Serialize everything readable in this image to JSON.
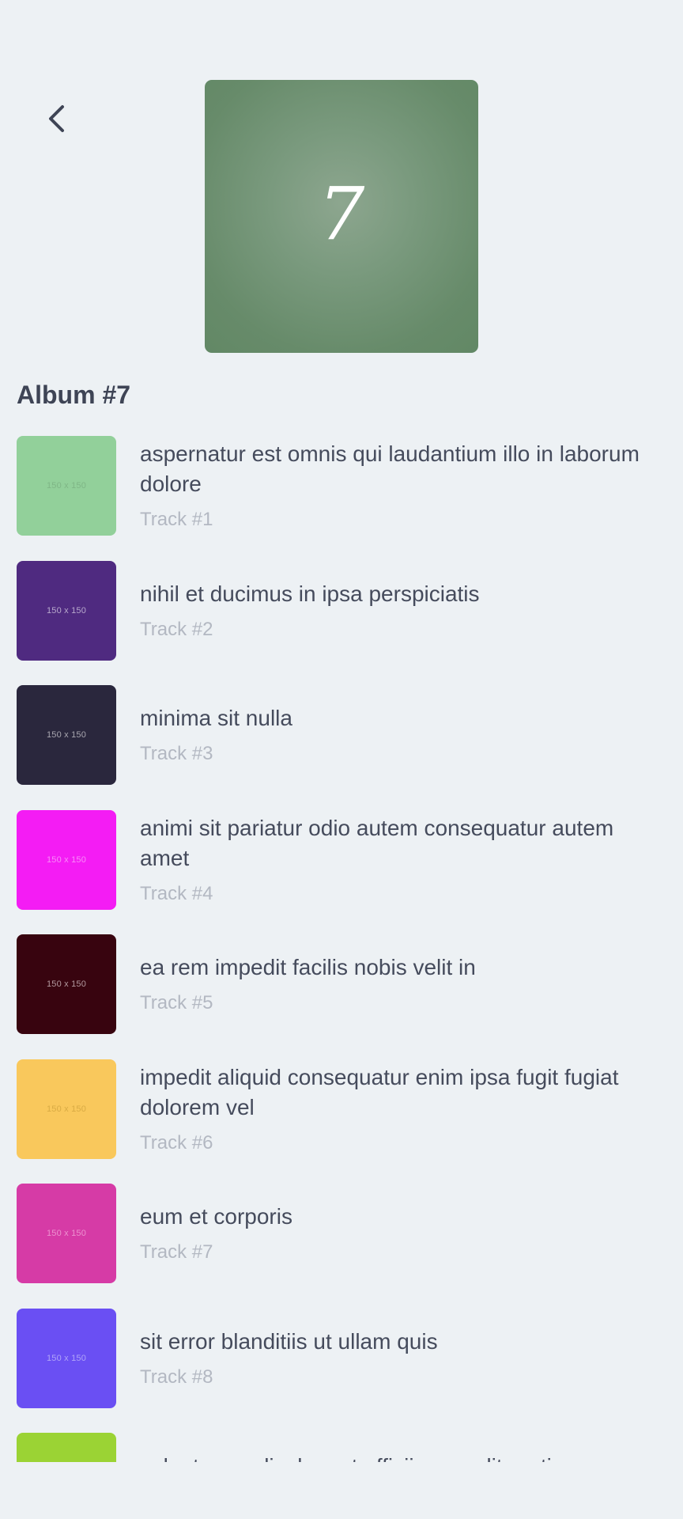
{
  "header": {
    "back_icon": "chevron-left-icon",
    "cover_numeral": "7"
  },
  "album": {
    "title": "Album #7"
  },
  "tracks": [
    {
      "title": "aspernatur est omnis qui laudantium illo in laborum dolore",
      "label": "Track #1",
      "thumb_text": "150 x 150",
      "thumb_color": "#92d09a",
      "thumb_text_color": "#7fb686"
    },
    {
      "title": "nihil et ducimus in ipsa perspiciatis",
      "label": "Track #2",
      "thumb_text": "150 x 150",
      "thumb_color": "#4f2a80",
      "thumb_text_color": "#b8a9cc"
    },
    {
      "title": "minima sit nulla",
      "label": "Track #3",
      "thumb_text": "150 x 150",
      "thumb_color": "#2a273d",
      "thumb_text_color": "#a9a7b0"
    },
    {
      "title": "animi sit pariatur odio autem consequatur autem amet",
      "label": "Track #4",
      "thumb_text": "150 x 150",
      "thumb_color": "#f41cf4",
      "thumb_text_color": "#f98af9"
    },
    {
      "title": "ea rem impedit facilis nobis velit in",
      "label": "Track #5",
      "thumb_text": "150 x 150",
      "thumb_color": "#38040f",
      "thumb_text_color": "#b39a9f"
    },
    {
      "title": "impedit aliquid consequatur enim ipsa fugit fugiat dolorem vel",
      "label": "Track #6",
      "thumb_text": "150 x 150",
      "thumb_color": "#f9c85c",
      "thumb_text_color": "#d9ab44"
    },
    {
      "title": "eum et corporis",
      "label": "Track #7",
      "thumb_text": "150 x 150",
      "thumb_color": "#d63ba6",
      "thumb_text_color": "#ed92d0"
    },
    {
      "title": "sit error blanditiis ut ullam quis",
      "label": "Track #8",
      "thumb_text": "150 x 150",
      "thumb_color": "#6a4ff3",
      "thumb_text_color": "#b0a4f8"
    },
    {
      "title": "voluptas explicabo est officiis expedita ratione",
      "label": "",
      "thumb_text": "",
      "thumb_color": "#9bd334",
      "thumb_text_color": "#9bd334"
    }
  ]
}
